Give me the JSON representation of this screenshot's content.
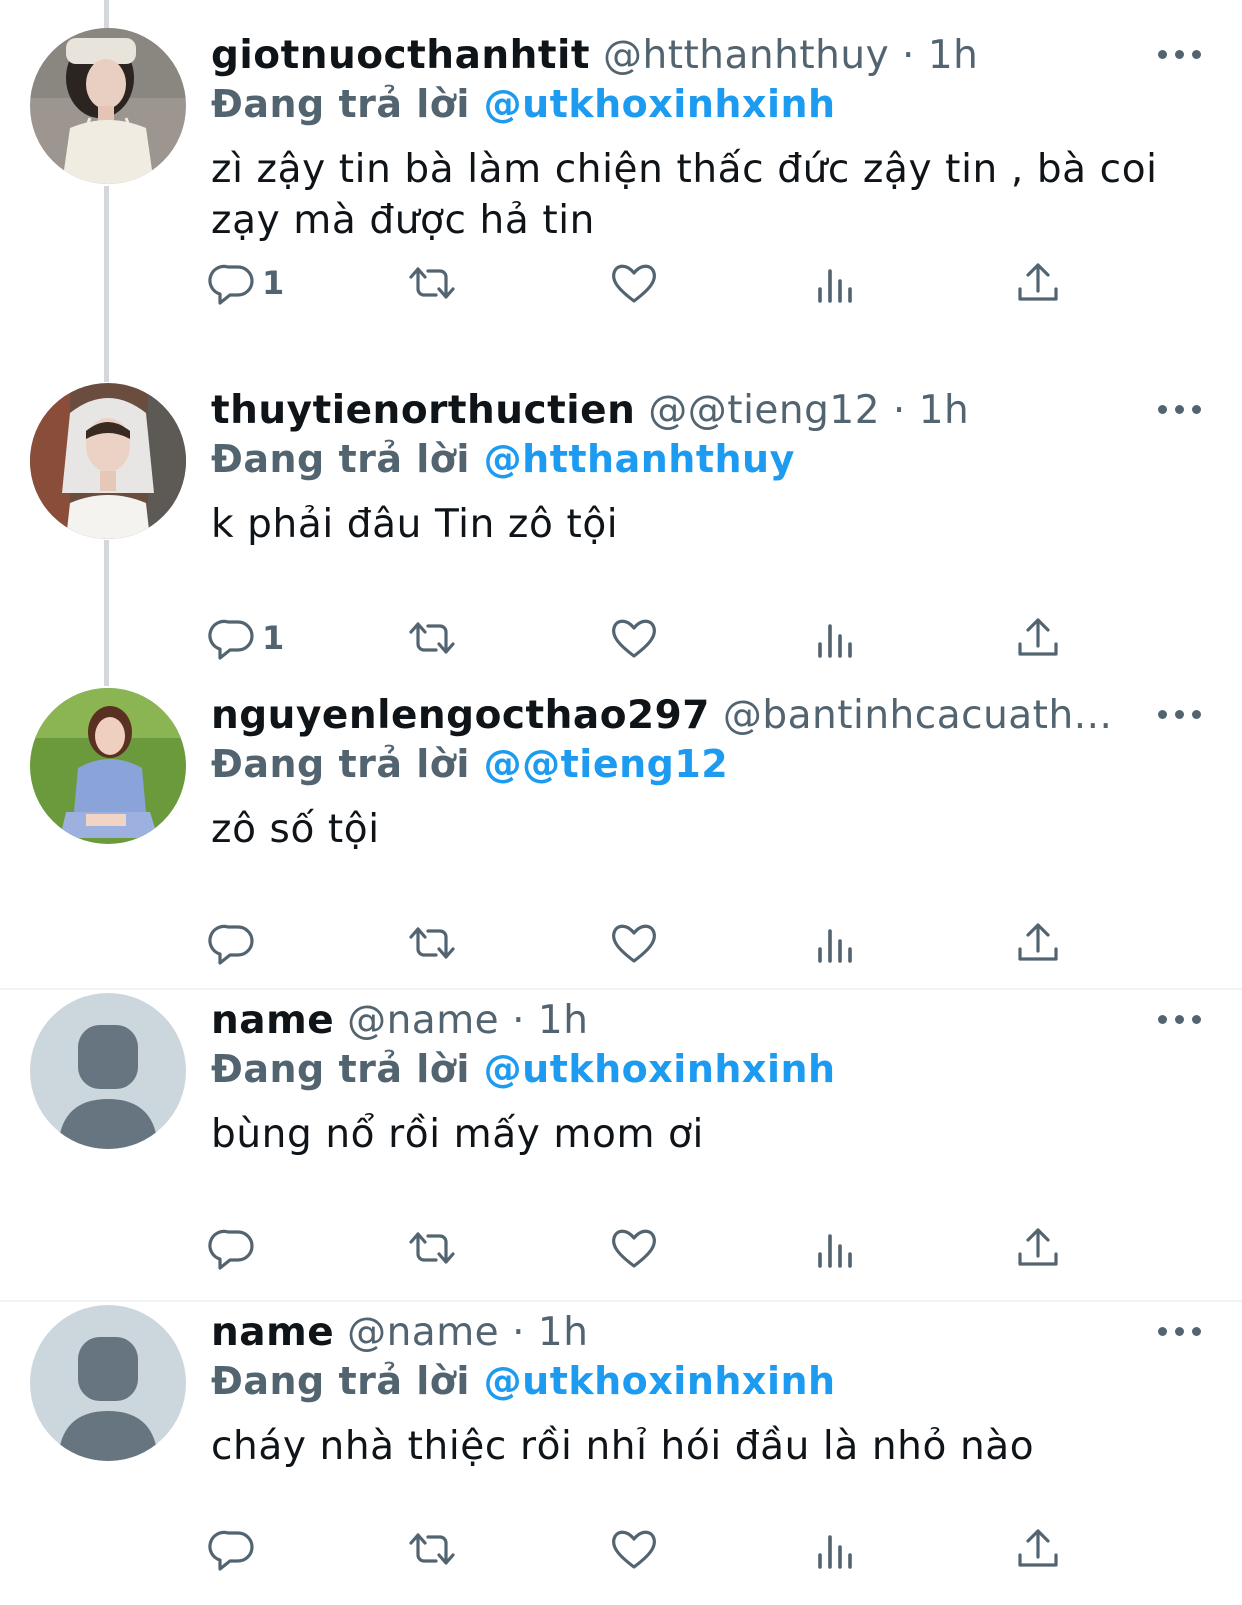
{
  "tweets": [
    {
      "display_name": "giotnuocthanhtit",
      "handle": "@htthanhthuy",
      "separator": " · ",
      "time": "1h",
      "replying_label": "Đang trả lời",
      "replying_to": "@utkhoxinhxinh",
      "text": "zì zậy tin bà làm chiện thấc đức zậy tin , bà coi zạy mà được hả tin",
      "reply_count": "1",
      "avatar": "photo-avatar"
    },
    {
      "display_name": "thuytienorthuctien",
      "handle": "@@tieng12",
      "separator": " · ",
      "time": "1h",
      "replying_label": "Đang trả lời",
      "replying_to": "@htthanhthuy",
      "text": "k phải đâu Tin zô tội",
      "reply_count": "1",
      "avatar": "photo-avatar"
    },
    {
      "display_name": "nguyenlengocthao297",
      "handle": "@bantinhcacuath...",
      "separator": "",
      "time": "",
      "replying_label": "Đang trả lời",
      "replying_to": "@@tieng12",
      "text": "zô số tội",
      "reply_count": "",
      "avatar": "photo-avatar"
    },
    {
      "display_name": "name",
      "handle": "@name",
      "separator": " · ",
      "time": "1h",
      "replying_label": "Đang trả lời",
      "replying_to": "@utkhoxinhxinh",
      "text": "bùng nổ rồi mấy mom ơi",
      "reply_count": "",
      "avatar": "default-avatar"
    },
    {
      "display_name": "name",
      "handle": "@name",
      "separator": " · ",
      "time": "1h",
      "replying_label": "Đang trả lời",
      "replying_to": "@utkhoxinhxinh",
      "text": "cháy nhà thiệc rồi nhỉ hói đầu là nhỏ nào",
      "reply_count": "",
      "avatar": "default-avatar"
    }
  ],
  "icons": {
    "reply": "reply-icon",
    "retweet": "retweet-icon",
    "like": "heart-icon",
    "views": "views-icon",
    "share": "share-icon",
    "more": "more-icon"
  },
  "colors": {
    "text": "#0f1419",
    "secondary": "#536471",
    "accent": "#1d9bf0",
    "thread_line": "#d4d8dc",
    "divider": "#eff3f4"
  }
}
